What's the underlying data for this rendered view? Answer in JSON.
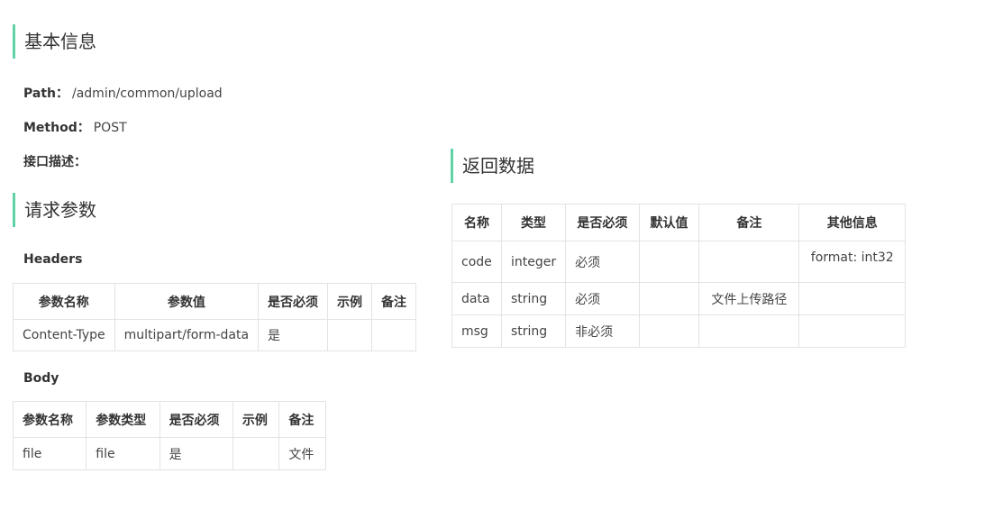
{
  "basic": {
    "title": "基本信息",
    "path_label": "Path：",
    "path_value": "/admin/common/upload",
    "method_label": "Method：",
    "method_value": "POST",
    "desc_label": "接口描述："
  },
  "request": {
    "title": "请求参数",
    "headers_label": "Headers",
    "headers_table": {
      "columns": [
        "参数名称",
        "参数值",
        "是否必须",
        "示例",
        "备注"
      ],
      "rows": [
        [
          "Content-Type",
          "multipart/form-data",
          "是",
          "",
          ""
        ]
      ]
    },
    "body_label": "Body",
    "body_table": {
      "columns": [
        "参数名称",
        "参数类型",
        "是否必须",
        "示例",
        "备注"
      ],
      "rows": [
        [
          "file",
          "file",
          "是",
          "",
          "文件"
        ]
      ]
    }
  },
  "response": {
    "title": "返回数据",
    "table": {
      "columns": [
        "名称",
        "类型",
        "是否必须",
        "默认值",
        "备注",
        "其他信息"
      ],
      "rows": [
        [
          "code",
          "integer",
          "必须",
          "",
          "",
          "format: int32"
        ],
        [
          "data",
          "string",
          "必须",
          "",
          "文件上传路径",
          ""
        ],
        [
          "msg",
          "string",
          "非必须",
          "",
          "",
          ""
        ]
      ]
    }
  },
  "colors": {
    "accent": "#5fd3a5",
    "border": "#e3e3e3"
  }
}
